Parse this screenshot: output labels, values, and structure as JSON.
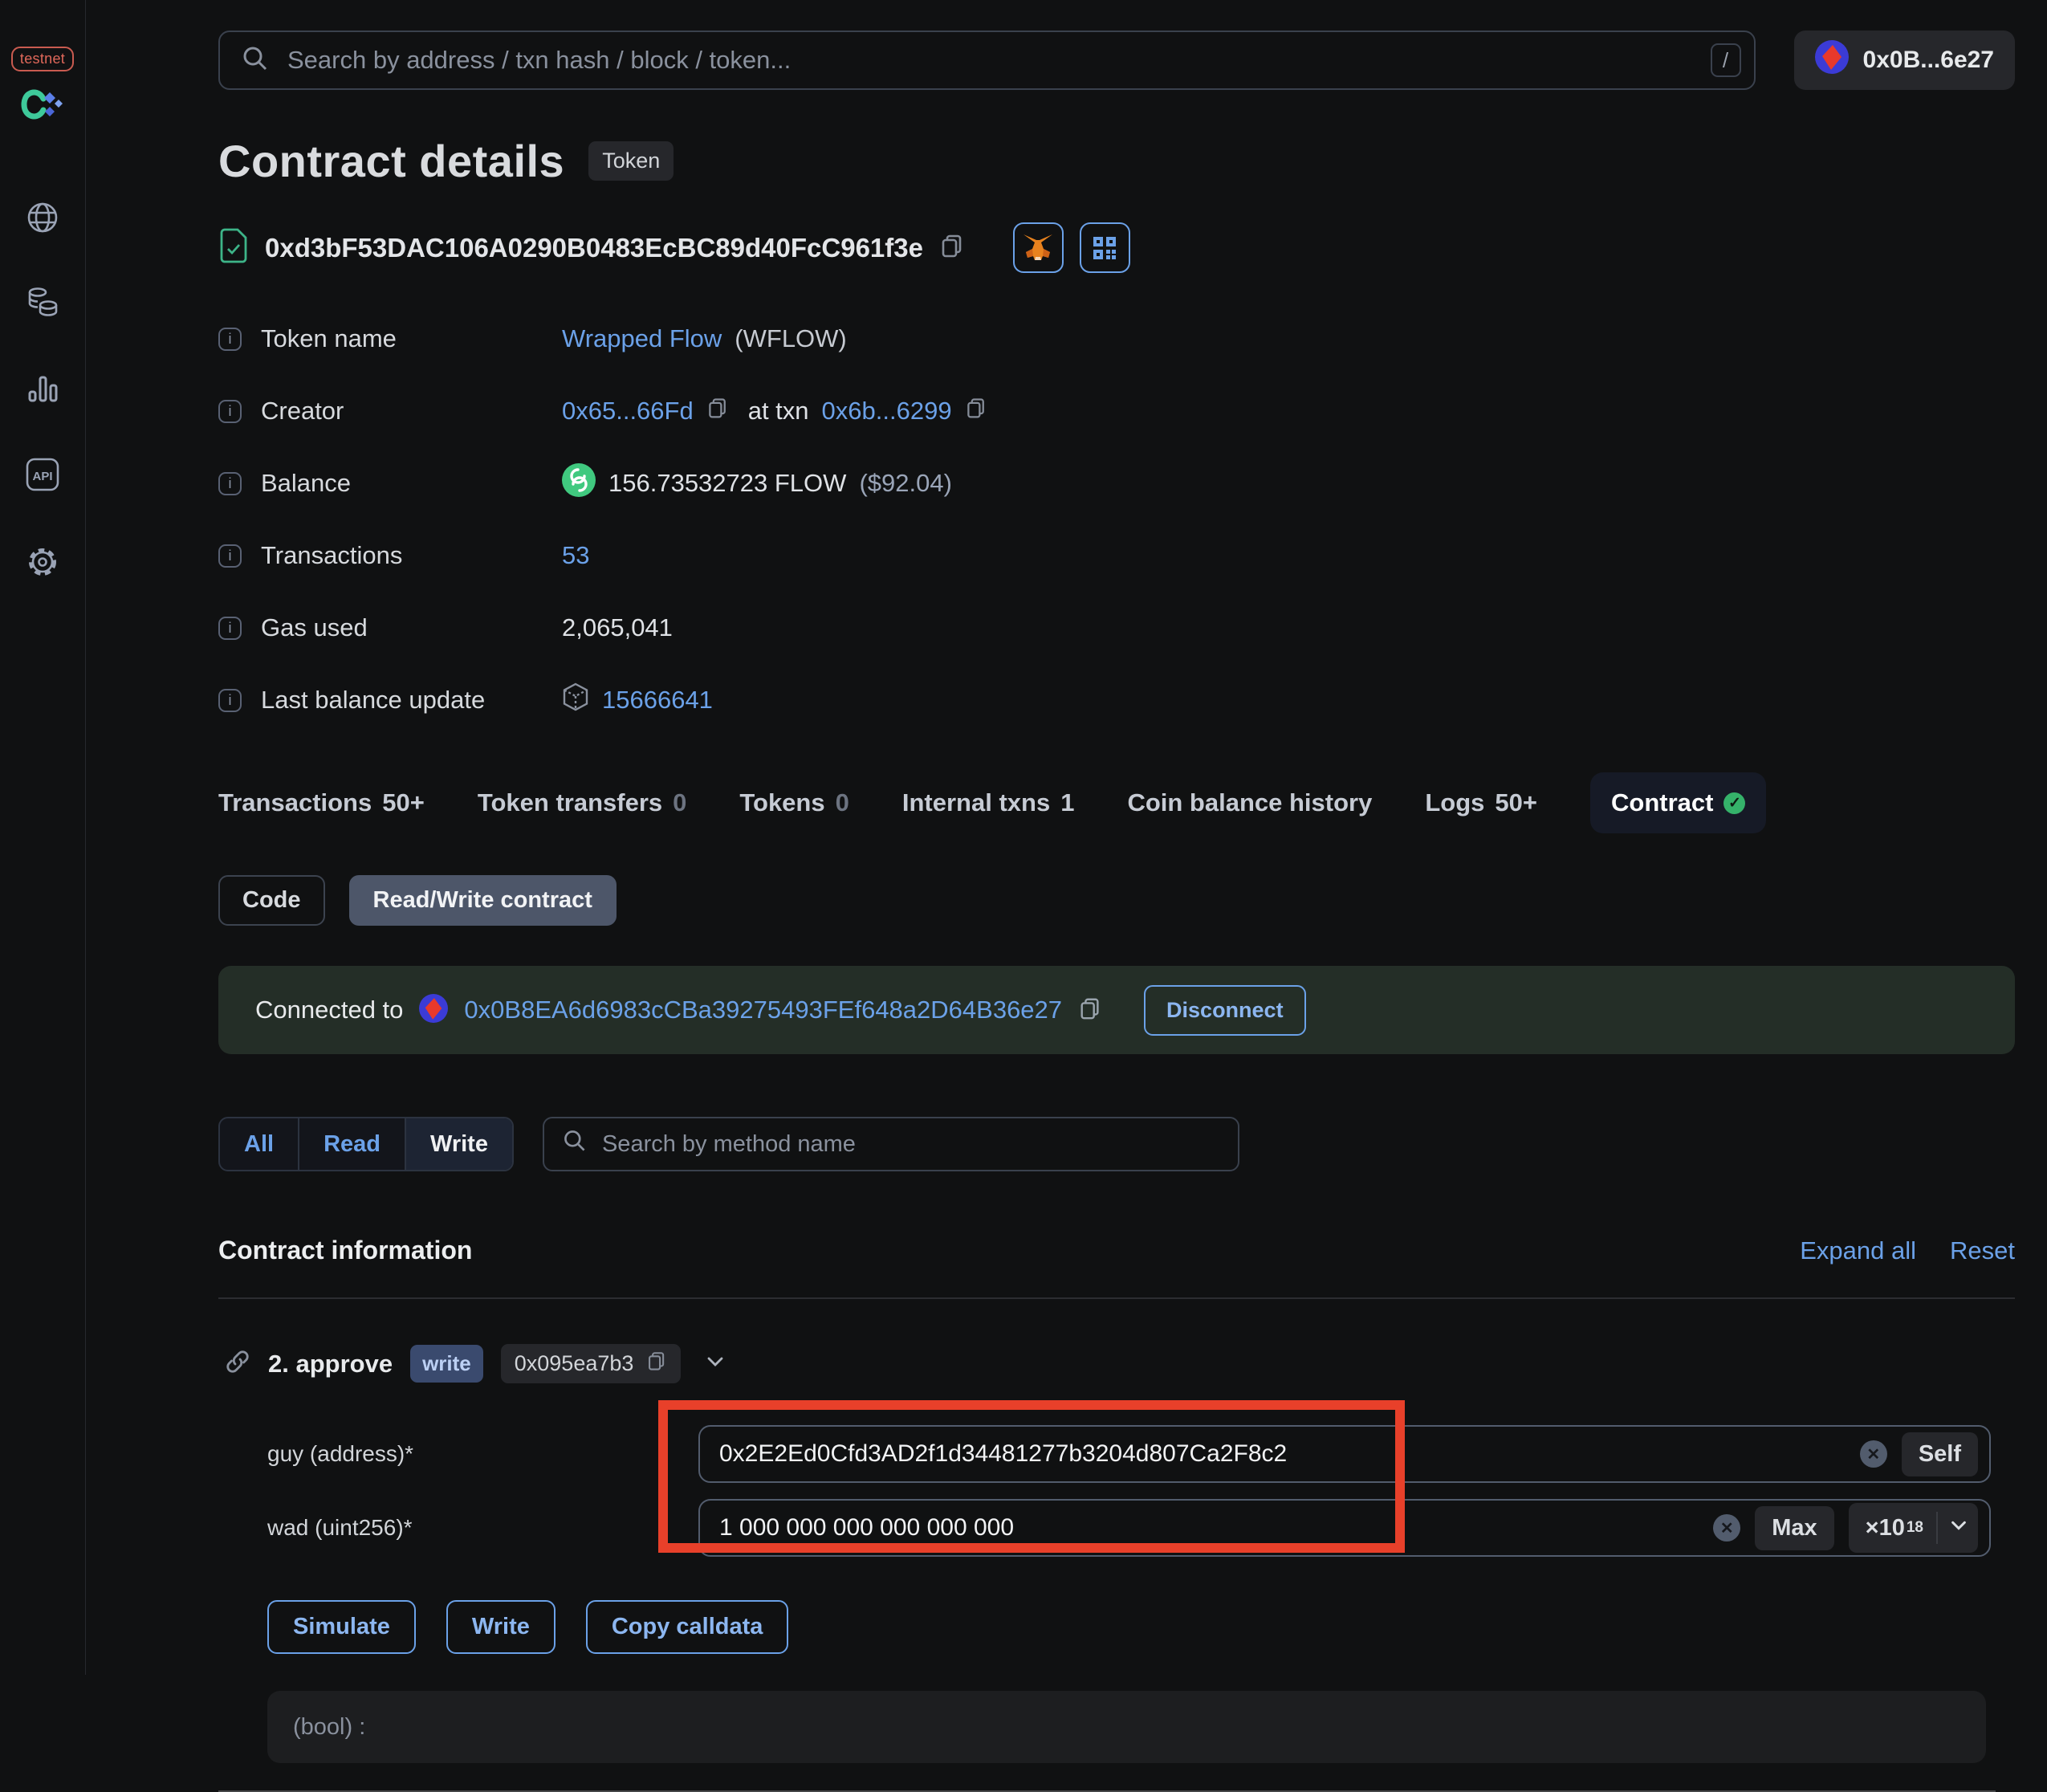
{
  "app": {
    "network_badge": "testnet",
    "search_placeholder": "Search by address / txn hash / block / token...",
    "search_hotkey": "/",
    "wallet_address_short": "0x0B...6e27"
  },
  "page": {
    "title": "Contract details",
    "type_badge": "Token",
    "contract_address": "0xd3bF53DAC106A0290B0483EcBC89d40FcC961f3e"
  },
  "info": {
    "rows": [
      {
        "label": "Token name",
        "link": "Wrapped Flow",
        "suffix": "(WFLOW)"
      },
      {
        "label": "Creator",
        "creator": "0x65...66Fd",
        "mid": "at txn",
        "txn": "0x6b...6299"
      },
      {
        "label": "Balance",
        "amount": "156.73532723 FLOW",
        "usd": "($92.04)"
      },
      {
        "label": "Transactions",
        "value": "53"
      },
      {
        "label": "Gas used",
        "value": "2,065,041"
      },
      {
        "label": "Last balance update",
        "value": "15666641"
      }
    ]
  },
  "tabs": [
    {
      "label": "Transactions",
      "count": "50+"
    },
    {
      "label": "Token transfers",
      "count": "0"
    },
    {
      "label": "Tokens",
      "count": "0"
    },
    {
      "label": "Internal txns",
      "count": "1"
    },
    {
      "label": "Coin balance history",
      "count": ""
    },
    {
      "label": "Logs",
      "count": "50+"
    },
    {
      "label": "Contract",
      "count": ""
    }
  ],
  "subtabs": {
    "code": "Code",
    "read_write": "Read/Write contract"
  },
  "connection": {
    "prefix": "Connected to",
    "address": "0x0B8EA6d6983cCBa39275493FEf648a2D64B36e27",
    "disconnect": "Disconnect"
  },
  "filter": {
    "all": "All",
    "read": "Read",
    "write": "Write",
    "search_placeholder": "Search by method name"
  },
  "contract_info": {
    "heading": "Contract information",
    "expand_all": "Expand all",
    "reset": "Reset"
  },
  "method": {
    "name": "2. approve",
    "badge": "write",
    "selector": "0x095ea7b3",
    "fields": [
      {
        "label": "guy (address)*",
        "value": "0x2E2Ed0Cfd3AD2f1d34481277b3204d807Ca2F8c2",
        "action": "Self"
      },
      {
        "label": "wad (uint256)*",
        "value": "1 000 000 000 000 000 000",
        "action": "Max",
        "multiplier": "×10",
        "exponent": "18"
      }
    ],
    "buttons": {
      "simulate": "Simulate",
      "write": "Write",
      "copy": "Copy calldata"
    },
    "output": "(bool) :"
  },
  "colors": {
    "background": "#101112",
    "link_blue": "#6ba1e8",
    "accent_green": "#35b26a",
    "annotation_red": "#e8402a",
    "connected_banner": "#242e27"
  }
}
